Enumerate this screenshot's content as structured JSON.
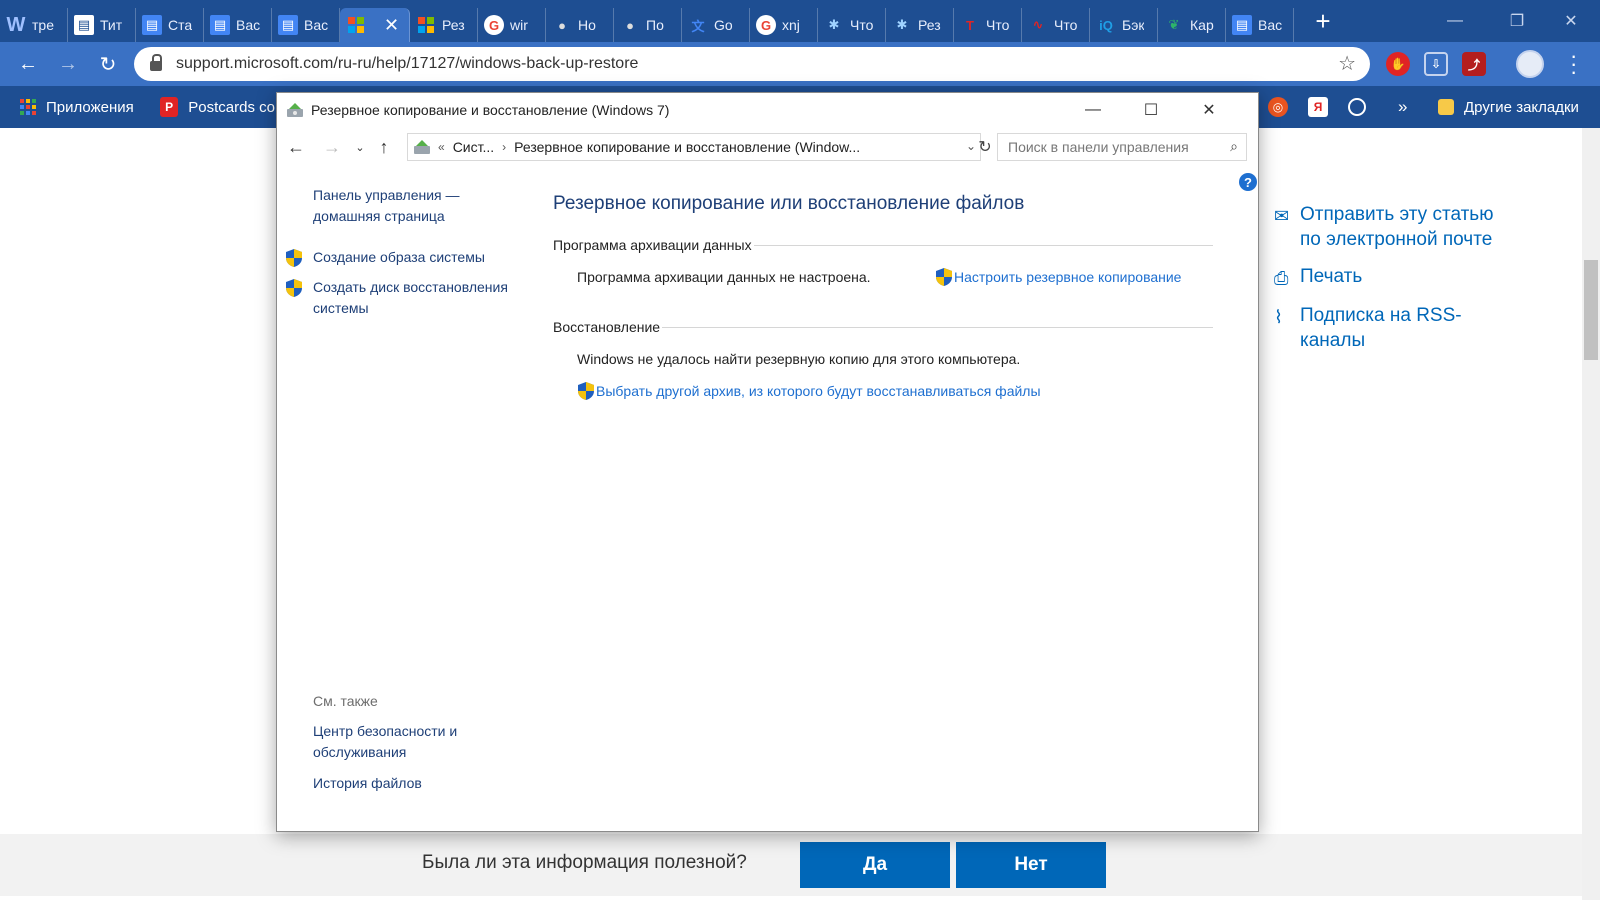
{
  "browser": {
    "tabs": [
      {
        "favicon": "W",
        "label": "тре",
        "color": "#2b579a"
      },
      {
        "favicon": "doc",
        "label": "Тит",
        "color": "#ffffff"
      },
      {
        "favicon": "gdoc",
        "label": "Ста",
        "color": "#4285f4"
      },
      {
        "favicon": "gdoc",
        "label": "Вас",
        "color": "#4285f4"
      },
      {
        "favicon": "gdoc",
        "label": "Вас",
        "color": "#4285f4"
      },
      {
        "favicon": "ms",
        "label": "",
        "color": "#f25022"
      },
      {
        "favicon": "ms",
        "label": "Рез",
        "color": "#f25022"
      },
      {
        "favicon": "G",
        "label": "wir",
        "color": "#ea4335"
      },
      {
        "favicon": "apple",
        "label": "Но",
        "color": "#dddddd"
      },
      {
        "favicon": "apple",
        "label": "По",
        "color": "#dddddd"
      },
      {
        "favicon": "gt",
        "label": "Go",
        "color": "#4285f4"
      },
      {
        "favicon": "G",
        "label": "xnj",
        "color": "#ea4335"
      },
      {
        "favicon": "sun",
        "label": "Что",
        "color": "#9fd2ff"
      },
      {
        "favicon": "sun",
        "label": "Рез",
        "color": "#9fd2ff"
      },
      {
        "favicon": "T",
        "label": "Что",
        "color": "#e02424"
      },
      {
        "favicon": "sig",
        "label": "Что",
        "color": "#e02424"
      },
      {
        "favicon": "iQ",
        "label": "Бэк",
        "color": "#1f9fe6"
      },
      {
        "favicon": "leaf",
        "label": "Кар",
        "color": "#2db36a"
      },
      {
        "favicon": "gdoc",
        "label": "Вас",
        "color": "#4285f4"
      }
    ],
    "active_tab_close": "✕",
    "new_tab": "+",
    "url": "support.microsoft.com/ru-ru/help/17127/windows-back-up-restore",
    "bookmarks": {
      "apps": "Приложения",
      "postcards": "Postcards cor",
      "overflow": "»",
      "other": "Другие закладки"
    }
  },
  "window": {
    "title": "Резервное копирование и восстановление (Windows 7)",
    "breadcrumb_prefix": "«",
    "breadcrumb_1": "Сист...",
    "breadcrumb_2": "Резервное копирование и восстановление (Window...",
    "search_placeholder": "Поиск в панели управления",
    "help": "?",
    "left": {
      "home": "Панель управления — домашняя страница",
      "task1": "Создание образа системы",
      "task2": "Создать диск восстановления системы",
      "see_also": "См. также",
      "link1": "Центр безопасности и обслуживания",
      "link2": "История файлов"
    },
    "main": {
      "heading": "Резервное копирование или восстановление файлов",
      "backup_group": "Программа архивации данных",
      "backup_status": "Программа архивации данных не настроена.",
      "backup_action": "Настроить резервное копирование",
      "restore_group": "Восстановление",
      "restore_status": "Windows не удалось найти резервную копию для этого компьютера.",
      "restore_action": "Выбрать другой архив, из которого будут восстанавливаться файлы"
    }
  },
  "page": {
    "side_links": [
      {
        "icon": "mail-icon",
        "label": "Отправить эту статью по электронной почте"
      },
      {
        "icon": "print-icon",
        "label": "Печать"
      },
      {
        "icon": "rss-icon",
        "label": "Подписка на RSS-каналы"
      }
    ],
    "feedback_question": "Была ли эта информация полезной?",
    "yes": "Да",
    "no": "Нет"
  },
  "colors": {
    "chrome_dark": "#1e4e92",
    "chrome_light": "#3a71c4",
    "link": "#1e6fd0",
    "ms_blue": "#0067b8"
  }
}
